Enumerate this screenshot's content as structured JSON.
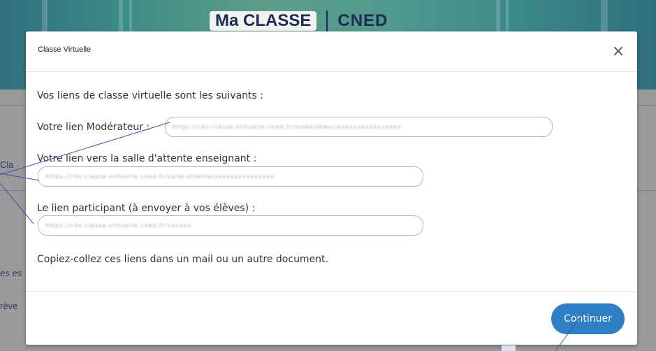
{
  "background": {
    "logo_ma": "Ma CLASSE",
    "logo_cned": "CNED",
    "side_fragments": [
      "Cla",
      "es es",
      "réve"
    ]
  },
  "modal": {
    "title": "Classe Virtuelle",
    "close_icon": "close-icon",
    "intro": "Vos liens de classe virtuelle sont les suivants :",
    "moderator_label": "Votre lien Modérateur :",
    "moderator_value": "https://rdv-classe-virtuelle.cned.fr/moderateur/xxxxxxxxxxxxxxxx",
    "waiting_room_label": "Votre lien vers la salle d'attente enseignant :",
    "waiting_room_value": "https://rdv-classe-virtuelle.cned.fr/salle-attente/xxxxxxxxxxxxxxx",
    "participant_label": "Le lien participant (à envoyer à vos élèves) :",
    "participant_value": "https://rdv-classe-virtuelle.cned.fr/xxxxxx",
    "instruction": "Copiez-collez ces liens dans un mail ou un autre document.",
    "continue_button": "Continuer"
  },
  "colors": {
    "primary_button": "#2f7fc4",
    "annotation_line": "#3a56a8"
  }
}
